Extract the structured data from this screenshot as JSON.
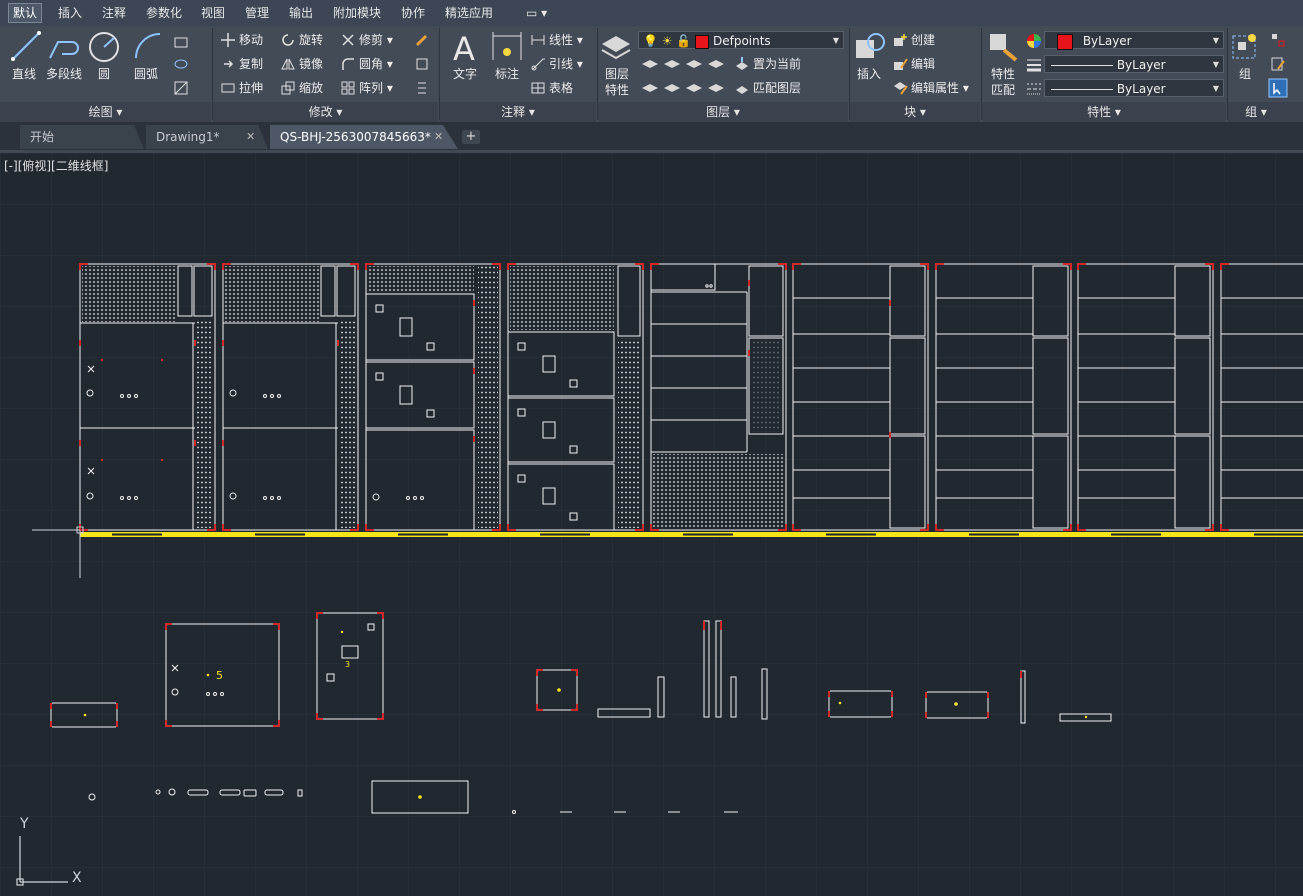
{
  "menu": {
    "items": [
      "默认",
      "插入",
      "注释",
      "参数化",
      "视图",
      "管理",
      "输出",
      "附加模块",
      "协作",
      "精选应用"
    ],
    "active_index": 0,
    "extra_label": "▭ ▾"
  },
  "ribbon": {
    "draw": {
      "title": "绘图 ▾",
      "line": "直线",
      "polyline": "多段线",
      "circle": "圆",
      "arc": "圆弧"
    },
    "modify": {
      "title": "修改 ▾",
      "move": "移动",
      "rotate": "旋转",
      "trim": "修剪",
      "copy": "复制",
      "mirror": "镜像",
      "fillet": "圆角",
      "stretch": "拉伸",
      "scale": "缩放",
      "array": "阵列"
    },
    "annotation": {
      "title": "注释 ▾",
      "text": "文字",
      "dimension": "标注",
      "linear": "线性",
      "leader": "引线",
      "table": "表格"
    },
    "layers": {
      "title": "图层 ▾",
      "layer_props": "图层\n特性",
      "layer_props_l1": "图层",
      "layer_props_l2": "特性",
      "current_layer": "Defpoints",
      "set_current": "置为当前",
      "match_layer": "匹配图层"
    },
    "block": {
      "title": "块 ▾",
      "insert": "插入",
      "create": "创建",
      "edit": "编辑",
      "edit_attributes": "编辑属性"
    },
    "properties": {
      "title": "特性 ▾",
      "match_l1": "特性",
      "match_l2": "匹配",
      "color": "ByLayer",
      "linetype": "ByLayer",
      "lineweight": "ByLayer"
    },
    "groups": {
      "title": "组 ▾",
      "group": "组"
    }
  },
  "tabs": [
    {
      "label": "开始",
      "active": false,
      "closable": false
    },
    {
      "label": "Drawing1*",
      "active": false,
      "closable": true
    },
    {
      "label": "QS-BHJ-2563007845663*",
      "active": true,
      "closable": true
    }
  ],
  "tab_add": "+",
  "tab_close": "✕",
  "viewport": {
    "label": "[-][俯视][二维线框]"
  },
  "drawing": {
    "labels": [
      "5",
      "3"
    ],
    "ucs_x": "X",
    "ucs_y": "Y"
  },
  "colors": {
    "background": "#212830",
    "grid": "#2a323d",
    "geometry_white": "#f2f2f2",
    "geometry_red": "#d22a2a",
    "ground_line": "#f5e51a",
    "layer_swatch": "#e8141b"
  }
}
